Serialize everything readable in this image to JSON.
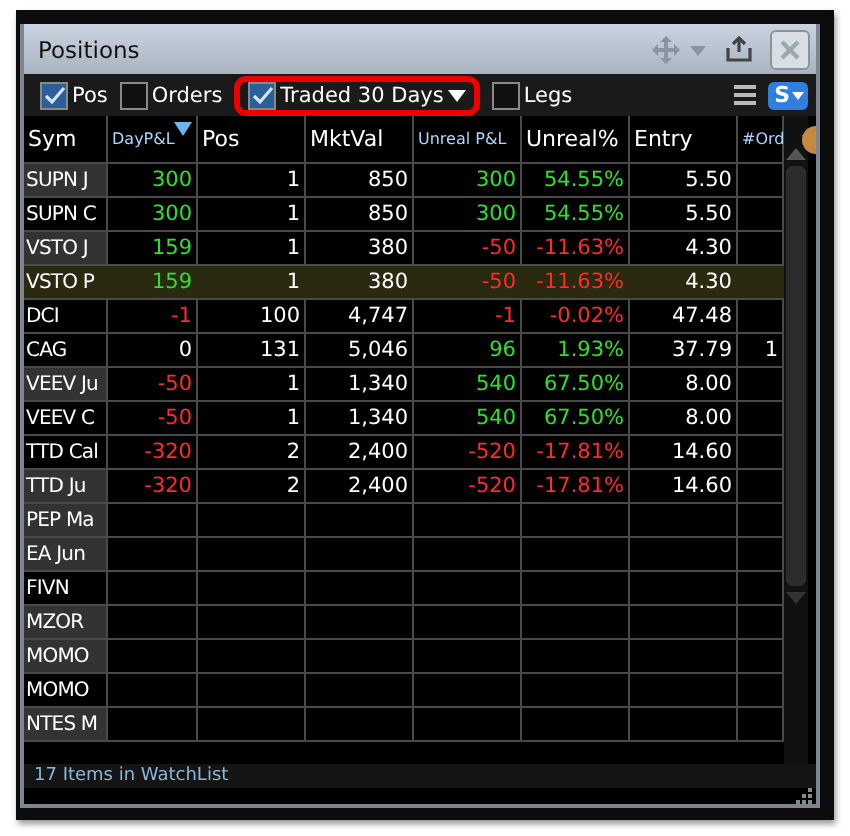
{
  "window": {
    "title": "Positions"
  },
  "toolbar": {
    "filters": [
      {
        "label": "Pos",
        "checked": true,
        "has_menu": false,
        "emphasized": false
      },
      {
        "label": "Orders",
        "checked": false,
        "has_menu": false,
        "emphasized": false
      },
      {
        "label": "Traded 30 Days",
        "checked": true,
        "has_menu": true,
        "emphasized": true
      },
      {
        "label": "Legs",
        "checked": false,
        "has_menu": false,
        "emphasized": false
      }
    ],
    "s_button": "S"
  },
  "table": {
    "columns": [
      {
        "label": "Sym",
        "small": false,
        "sorted": false
      },
      {
        "label": "DayP&L",
        "small": true,
        "sorted": true
      },
      {
        "label": "Pos",
        "small": false,
        "sorted": false
      },
      {
        "label": "MktVal",
        "small": false,
        "sorted": false
      },
      {
        "label": "Unreal P&L",
        "small": true,
        "sorted": false
      },
      {
        "label": "Unreal%",
        "small": false,
        "sorted": false
      },
      {
        "label": "Entry",
        "small": false,
        "sorted": false
      },
      {
        "label": "#Ord",
        "small": true,
        "sorted": false
      }
    ],
    "rows": [
      {
        "shaded": true,
        "selected": false,
        "cells": [
          {
            "text": "SUPN J"
          },
          {
            "text": "300",
            "up": true
          },
          {
            "text": "1"
          },
          {
            "text": "850"
          },
          {
            "text": "300",
            "up": true
          },
          {
            "text": "54.55%",
            "up": true
          },
          {
            "text": "5.50"
          },
          {
            "text": ""
          }
        ]
      },
      {
        "shaded": false,
        "selected": false,
        "cells": [
          {
            "text": "SUPN C"
          },
          {
            "text": "300",
            "up": true
          },
          {
            "text": "1"
          },
          {
            "text": "850"
          },
          {
            "text": "300",
            "up": true
          },
          {
            "text": "54.55%",
            "up": true
          },
          {
            "text": "5.50"
          },
          {
            "text": ""
          }
        ]
      },
      {
        "shaded": true,
        "selected": false,
        "cells": [
          {
            "text": "VSTO J"
          },
          {
            "text": "159",
            "up": true
          },
          {
            "text": "1"
          },
          {
            "text": "380"
          },
          {
            "text": "-50",
            "up": false
          },
          {
            "text": "-11.63%",
            "up": false
          },
          {
            "text": "4.30"
          },
          {
            "text": ""
          }
        ]
      },
      {
        "shaded": true,
        "selected": true,
        "cells": [
          {
            "text": "VSTO P"
          },
          {
            "text": "159",
            "up": true
          },
          {
            "text": "1"
          },
          {
            "text": "380"
          },
          {
            "text": "-50",
            "up": false
          },
          {
            "text": "-11.63%",
            "up": false
          },
          {
            "text": "4.30"
          },
          {
            "text": ""
          }
        ]
      },
      {
        "shaded": false,
        "selected": false,
        "cells": [
          {
            "text": "DCI"
          },
          {
            "text": "-1",
            "up": false
          },
          {
            "text": "100"
          },
          {
            "text": "4,747"
          },
          {
            "text": "-1",
            "up": false
          },
          {
            "text": "-0.02%",
            "up": false
          },
          {
            "text": "47.48"
          },
          {
            "text": ""
          }
        ]
      },
      {
        "shaded": false,
        "selected": false,
        "cells": [
          {
            "text": "CAG"
          },
          {
            "text": "0"
          },
          {
            "text": "131"
          },
          {
            "text": "5,046"
          },
          {
            "text": "96",
            "up": true
          },
          {
            "text": "1.93%",
            "up": true
          },
          {
            "text": "37.79"
          },
          {
            "text": "1"
          }
        ]
      },
      {
        "shaded": true,
        "selected": false,
        "cells": [
          {
            "text": "VEEV Ju"
          },
          {
            "text": "-50",
            "up": false
          },
          {
            "text": "1"
          },
          {
            "text": "1,340"
          },
          {
            "text": "540",
            "up": true
          },
          {
            "text": "67.50%",
            "up": true
          },
          {
            "text": "8.00"
          },
          {
            "text": ""
          }
        ]
      },
      {
        "shaded": false,
        "selected": false,
        "cells": [
          {
            "text": "VEEV C"
          },
          {
            "text": "-50",
            "up": false
          },
          {
            "text": "1"
          },
          {
            "text": "1,340"
          },
          {
            "text": "540",
            "up": true
          },
          {
            "text": "67.50%",
            "up": true
          },
          {
            "text": "8.00"
          },
          {
            "text": ""
          }
        ]
      },
      {
        "shaded": false,
        "selected": false,
        "cells": [
          {
            "text": "TTD Cal"
          },
          {
            "text": "-320",
            "up": false
          },
          {
            "text": "2"
          },
          {
            "text": "2,400"
          },
          {
            "text": "-520",
            "up": false
          },
          {
            "text": "-17.81%",
            "up": false
          },
          {
            "text": "14.60"
          },
          {
            "text": ""
          }
        ]
      },
      {
        "shaded": true,
        "selected": false,
        "cells": [
          {
            "text": "TTD Ju"
          },
          {
            "text": "-320",
            "up": false
          },
          {
            "text": "2"
          },
          {
            "text": "2,400"
          },
          {
            "text": "-520",
            "up": false
          },
          {
            "text": "-17.81%",
            "up": false
          },
          {
            "text": "14.60"
          },
          {
            "text": ""
          }
        ]
      },
      {
        "shaded": true,
        "selected": false,
        "cells": [
          {
            "text": "PEP Ma"
          },
          {
            "text": ""
          },
          {
            "text": ""
          },
          {
            "text": ""
          },
          {
            "text": ""
          },
          {
            "text": ""
          },
          {
            "text": ""
          },
          {
            "text": ""
          }
        ]
      },
      {
        "shaded": true,
        "selected": false,
        "cells": [
          {
            "text": "EA Jun"
          },
          {
            "text": ""
          },
          {
            "text": ""
          },
          {
            "text": ""
          },
          {
            "text": ""
          },
          {
            "text": ""
          },
          {
            "text": ""
          },
          {
            "text": ""
          }
        ]
      },
      {
        "shaded": false,
        "selected": false,
        "cells": [
          {
            "text": "FIVN"
          },
          {
            "text": ""
          },
          {
            "text": ""
          },
          {
            "text": ""
          },
          {
            "text": ""
          },
          {
            "text": ""
          },
          {
            "text": ""
          },
          {
            "text": ""
          }
        ]
      },
      {
        "shaded": true,
        "selected": false,
        "cells": [
          {
            "text": "MZOR"
          },
          {
            "text": ""
          },
          {
            "text": ""
          },
          {
            "text": ""
          },
          {
            "text": ""
          },
          {
            "text": ""
          },
          {
            "text": ""
          },
          {
            "text": ""
          }
        ]
      },
      {
        "shaded": true,
        "selected": false,
        "cells": [
          {
            "text": "MOMO"
          },
          {
            "text": ""
          },
          {
            "text": ""
          },
          {
            "text": ""
          },
          {
            "text": ""
          },
          {
            "text": ""
          },
          {
            "text": ""
          },
          {
            "text": ""
          }
        ]
      },
      {
        "shaded": false,
        "selected": false,
        "cells": [
          {
            "text": "MOMO"
          },
          {
            "text": ""
          },
          {
            "text": ""
          },
          {
            "text": ""
          },
          {
            "text": ""
          },
          {
            "text": ""
          },
          {
            "text": ""
          },
          {
            "text": ""
          }
        ]
      },
      {
        "shaded": true,
        "selected": false,
        "cells": [
          {
            "text": "NTES M"
          },
          {
            "text": ""
          },
          {
            "text": ""
          },
          {
            "text": ""
          },
          {
            "text": ""
          },
          {
            "text": ""
          },
          {
            "text": ""
          },
          {
            "text": ""
          }
        ]
      }
    ]
  },
  "status_bar": "17 Items in WatchList"
}
